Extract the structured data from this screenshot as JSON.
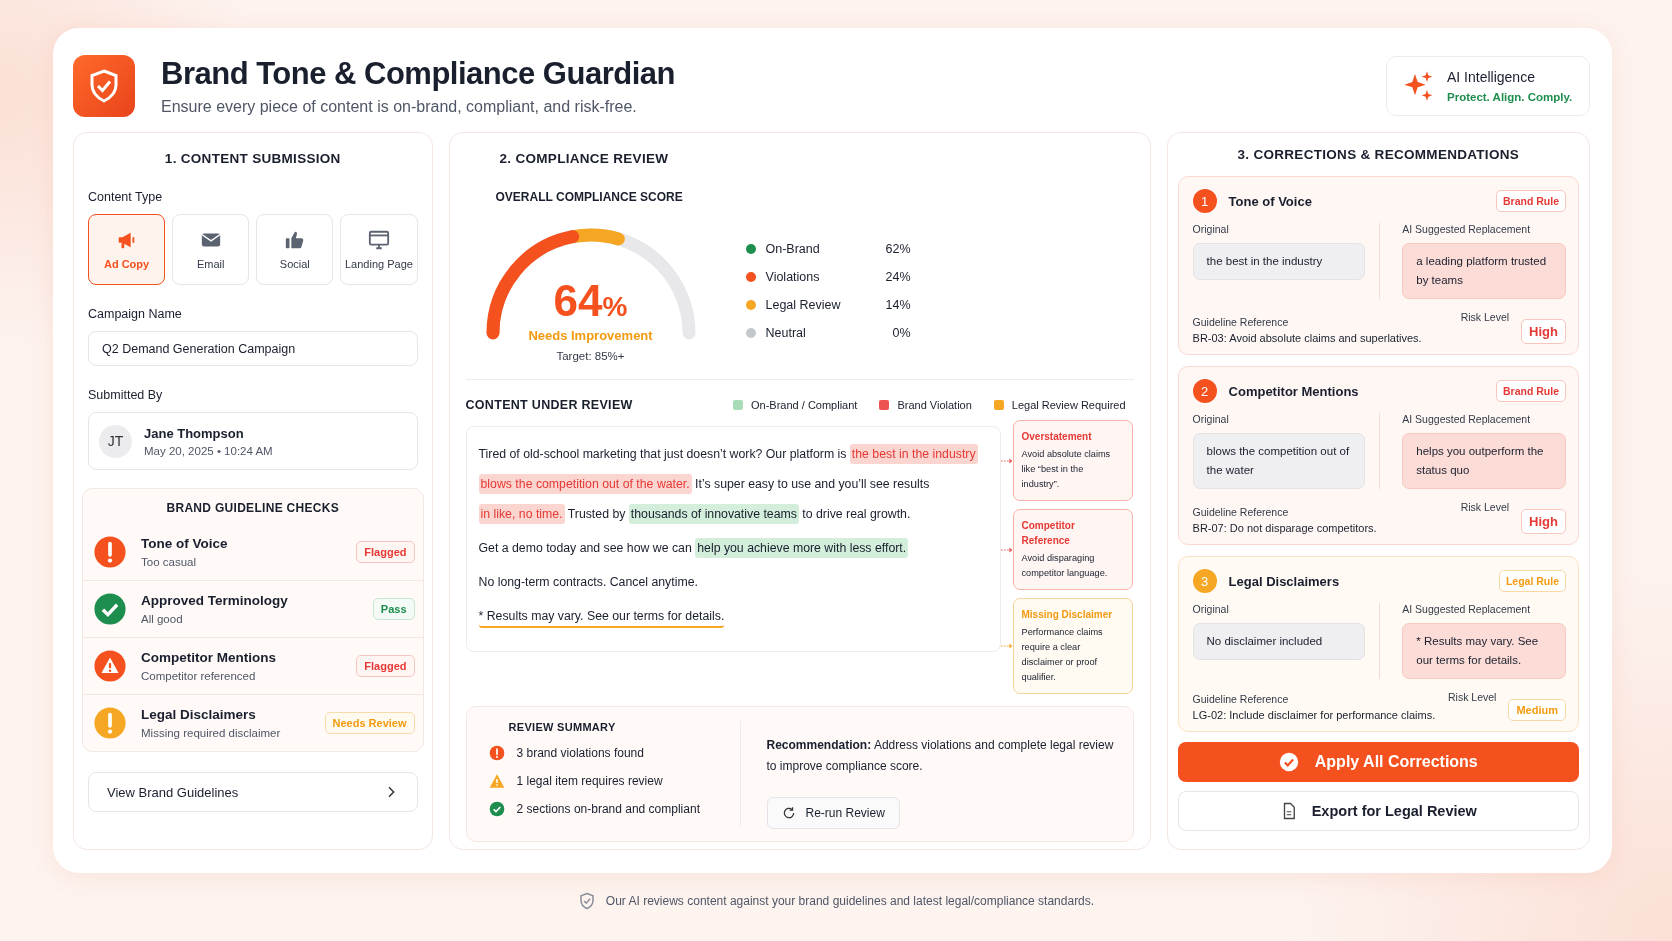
{
  "header": {
    "title": "Brand Tone & Compliance Guardian",
    "subtitle": "Ensure every piece of content is on-brand, compliant, and risk-free.",
    "badge": {
      "title": "AI Intelligence",
      "tagline": "Protect. Align. Comply."
    }
  },
  "submission": {
    "heading": "1. CONTENT SUBMISSION",
    "content_type_label": "Content Type",
    "content_types": [
      {
        "kind": "ad",
        "label": "Ad Copy",
        "selected": true
      },
      {
        "kind": "email",
        "label": "Email",
        "selected": false
      },
      {
        "kind": "social",
        "label": "Social",
        "selected": false
      },
      {
        "kind": "landing",
        "label": "Landing Page",
        "selected": false
      }
    ],
    "campaign_label": "Campaign Name",
    "campaign_value": "Q2 Demand Generation Campaign",
    "submitted_label": "Submitted By",
    "submitter": {
      "initials": "JT",
      "name": "Jane Thompson",
      "date": "May 20, 2025 • 10:24 AM"
    },
    "checks_heading": "BRAND GUIDELINE CHECKS",
    "checks": [
      {
        "kind": "error",
        "title": "Tone of Voice",
        "detail": "Too casual",
        "status": {
          "text": "Flagged",
          "kind": "flagged"
        }
      },
      {
        "kind": "pass",
        "title": "Approved Terminology",
        "detail": "All good",
        "status": {
          "text": "Pass",
          "kind": "pass"
        }
      },
      {
        "kind": "warning",
        "title": "Competitor Mentions",
        "detail": "Competitor referenced",
        "status": {
          "text": "Flagged",
          "kind": "flagged"
        }
      },
      {
        "kind": "caution",
        "title": "Legal Disclaimers",
        "detail": "Missing required disclaimer",
        "status": {
          "text": "Needs Review",
          "kind": "review"
        }
      }
    ],
    "guidelines_link": "View Brand Guidelines"
  },
  "review": {
    "heading": "2. COMPLIANCE REVIEW",
    "score_heading": "OVERALL COMPLIANCE SCORE",
    "score": {
      "value": "64",
      "unit": "%",
      "level": 0.64,
      "rating": "Needs Improvement",
      "target": "Target: 85%+"
    },
    "breakdown": [
      {
        "label": "On-Brand",
        "value": "62%",
        "color": "#1e8e4e"
      },
      {
        "label": "Violations",
        "value": "24%",
        "color": "#f4511e"
      },
      {
        "label": "Legal Review",
        "value": "14%",
        "color": "#f5a623"
      },
      {
        "label": "Neutral",
        "value": "0%",
        "color": "#c4c7cc"
      }
    ],
    "content_heading": "CONTENT UNDER REVIEW",
    "legend": [
      {
        "label": "On-Brand / Compliant",
        "color": "#a8dcb8"
      },
      {
        "label": "Brand Violation",
        "color": "#ef5350"
      },
      {
        "label": "Legal Review Required",
        "color": "#f5a623"
      }
    ],
    "paragraphs": [
      {
        "segments": [
          {
            "kind": "plain",
            "text": "Tired of old-school marketing that just doesn’t work? Our platform is"
          },
          {
            "kind": "violation",
            "text": "the best in the industry"
          },
          {
            "kind": "violation",
            "text": "blows the competition out of the water."
          },
          {
            "kind": "plain",
            "text": "It’s super easy to use and you’ll see results"
          },
          {
            "kind": "violation",
            "text": "in like, no time."
          },
          {
            "kind": "plain",
            "text": "Trusted by"
          },
          {
            "kind": "compliant",
            "text": "thousands of innovative teams"
          },
          {
            "kind": "plain",
            "text": "to drive real growth."
          }
        ]
      },
      {
        "segments": [
          {
            "kind": "plain",
            "text": "Get a demo today and see how we can"
          },
          {
            "kind": "compliant",
            "text": "help you achieve more with less effort."
          }
        ]
      },
      {
        "segments": [
          {
            "kind": "plain",
            "text": "No long-term contracts. Cancel anytime."
          }
        ]
      },
      {
        "segments": [
          {
            "kind": "legal",
            "text": "* Results may vary. See our terms for details."
          }
        ]
      }
    ],
    "annotations": [
      {
        "kind": "violation",
        "title": "Overstatement",
        "text": "Avoid absolute claims like “best in the industry”."
      },
      {
        "kind": "violation",
        "title": "Competitor Reference",
        "text": "Avoid disparaging competitor language."
      },
      {
        "kind": "legal",
        "title": "Missing Disclaimer",
        "text": "Performance claims require a clear disclaimer or proof qualifier."
      }
    ],
    "summary": {
      "heading": "REVIEW SUMMARY",
      "items": [
        {
          "kind": "error",
          "text": "3 brand violations found"
        },
        {
          "kind": "warning",
          "text": "1 legal item requires review"
        },
        {
          "kind": "pass",
          "text": "2 sections on-brand and compliant"
        }
      ],
      "recommendation": "**Recommendation:** Address violations and complete legal review to improve compliance score.",
      "rerun": "Re-run Review"
    }
  },
  "corrections": {
    "heading": "3. CORRECTIONS & RECOMMENDATIONS",
    "items": [
      {
        "number": "1",
        "kind": "brand",
        "title": "Tone of Voice",
        "rule": "Brand Rule",
        "original_label": "Original",
        "original": "the best in the industry",
        "replacement_label": "AI Suggested Replacement",
        "replacement": "a leading platform trusted by teams",
        "reference_label": "Guideline Reference",
        "reference": "BR-03: Avoid absolute claims and superlatives.",
        "risk_label": "Risk Level",
        "risk": {
          "text": "High",
          "kind": "high"
        }
      },
      {
        "number": "2",
        "kind": "brand",
        "title": "Competitor Mentions",
        "rule": "Brand Rule",
        "original_label": "Original",
        "original": "blows the competition out of the water",
        "replacement_label": "AI Suggested Replacement",
        "replacement": "helps you outperform the status quo",
        "reference_label": "Guideline Reference",
        "reference": "BR-07: Do not disparage competitors.",
        "risk_label": "Risk Level",
        "risk": {
          "text": "High",
          "kind": "high"
        }
      },
      {
        "number": "3",
        "kind": "legal",
        "title": "Legal Disclaimers",
        "rule": "Legal Rule",
        "original_label": "Original",
        "original": "No disclaimer included",
        "replacement_label": "AI Suggested Replacement",
        "replacement": "* Results may vary. See our terms for details.",
        "reference_label": "Guideline Reference",
        "reference": "LG-02: Include disclaimer for performance claims.",
        "risk_label": "Risk Level",
        "risk": {
          "text": "Medium",
          "kind": "medium"
        }
      }
    ],
    "apply": "Apply All Corrections",
    "export": "Export for Legal Review"
  },
  "footer": "Our AI reviews content against your brand guidelines and latest legal/compliance standards."
}
